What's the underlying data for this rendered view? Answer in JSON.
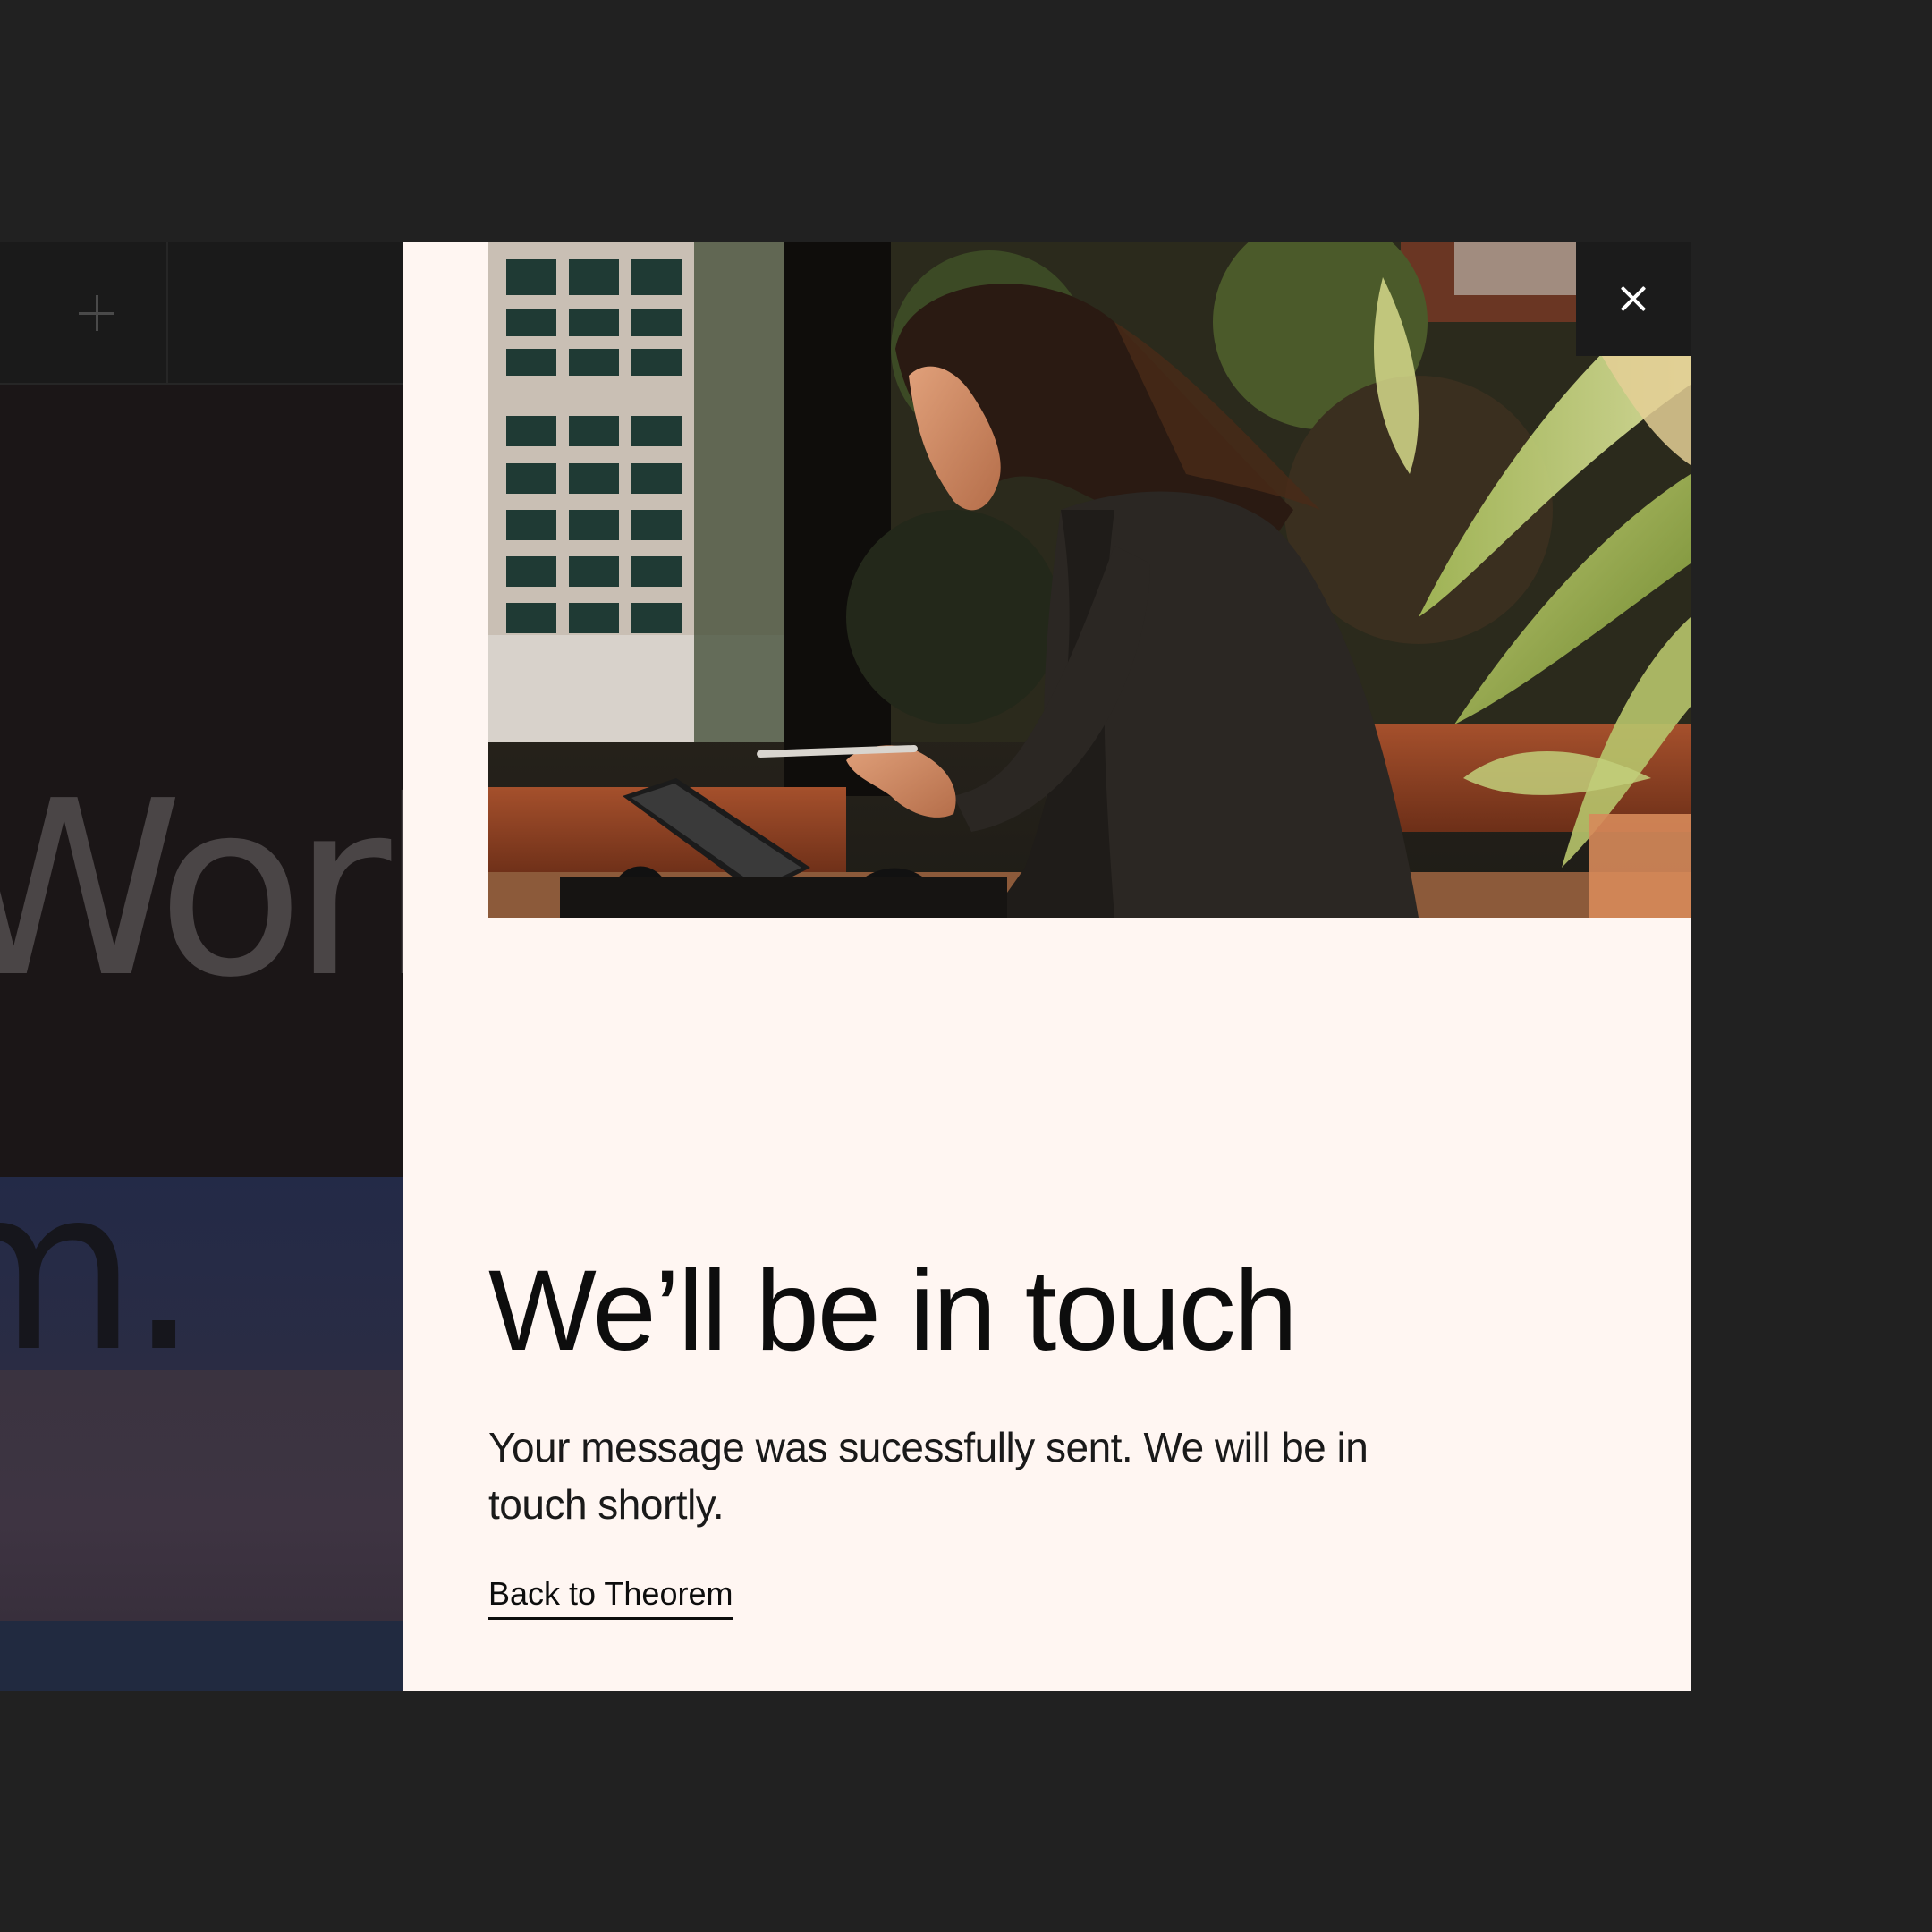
{
  "background_page": {
    "hero_word": "World",
    "band_word": "m.",
    "colors": {
      "page": "#212121",
      "hero": "#1b1617",
      "band_blue": "#232a47",
      "band_mauve": "#3a3340",
      "band_navy": "#212a40"
    }
  },
  "modal": {
    "title": "We’ll be in touch",
    "message": "Your message was sucessfully sent. We will be in touch shortly.",
    "back_link_label": "Back to Theorem",
    "close_icon": "close-icon",
    "photo_alt": "Woman writing on a tablet outdoors",
    "colors": {
      "background": "#fff6f2",
      "text": "#0d0d0d",
      "close_button": "#1b1b1b"
    }
  }
}
